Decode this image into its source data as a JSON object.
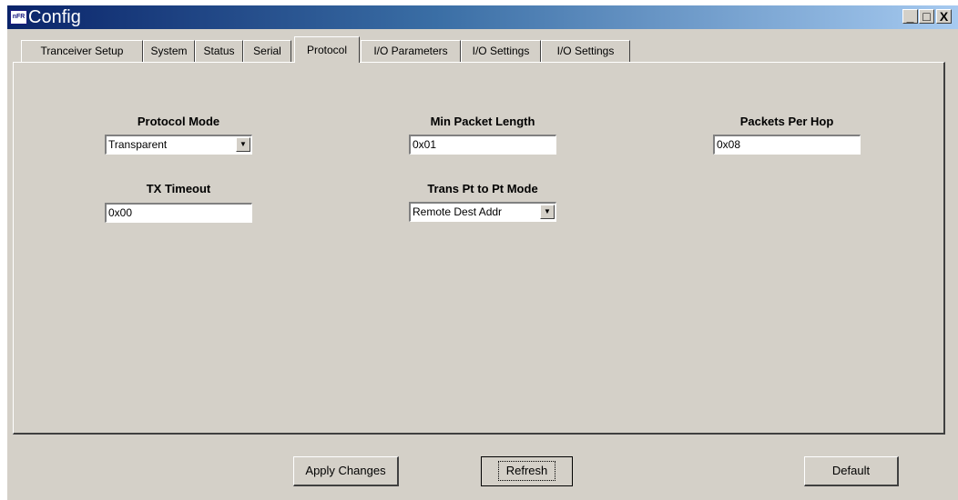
{
  "window": {
    "title": "Config",
    "icon_label": "nFR",
    "controls": {
      "minimize": "_",
      "maximize": "□",
      "close": "X"
    }
  },
  "tabs": [
    {
      "label": "Tranceiver Setup"
    },
    {
      "label": "System"
    },
    {
      "label": "Status"
    },
    {
      "label": "Serial"
    },
    {
      "label": "Protocol",
      "active": true
    },
    {
      "label": "I/O Parameters"
    },
    {
      "label": "I/O Settings"
    },
    {
      "label": "I/O Settings"
    }
  ],
  "protocol": {
    "protocol_mode": {
      "label": "Protocol Mode",
      "value": "Transparent"
    },
    "min_packet_length": {
      "label": "Min Packet Length",
      "value": "0x01"
    },
    "packets_per_hop": {
      "label": "Packets Per Hop",
      "value": "0x08"
    },
    "tx_timeout": {
      "label": "TX Timeout",
      "value": "0x00"
    },
    "trans_pt_to_pt_mode": {
      "label": "Trans Pt to Pt Mode",
      "value": "Remote Dest Addr"
    }
  },
  "buttons": {
    "apply": "Apply Changes",
    "refresh": "Refresh",
    "default": "Default"
  }
}
